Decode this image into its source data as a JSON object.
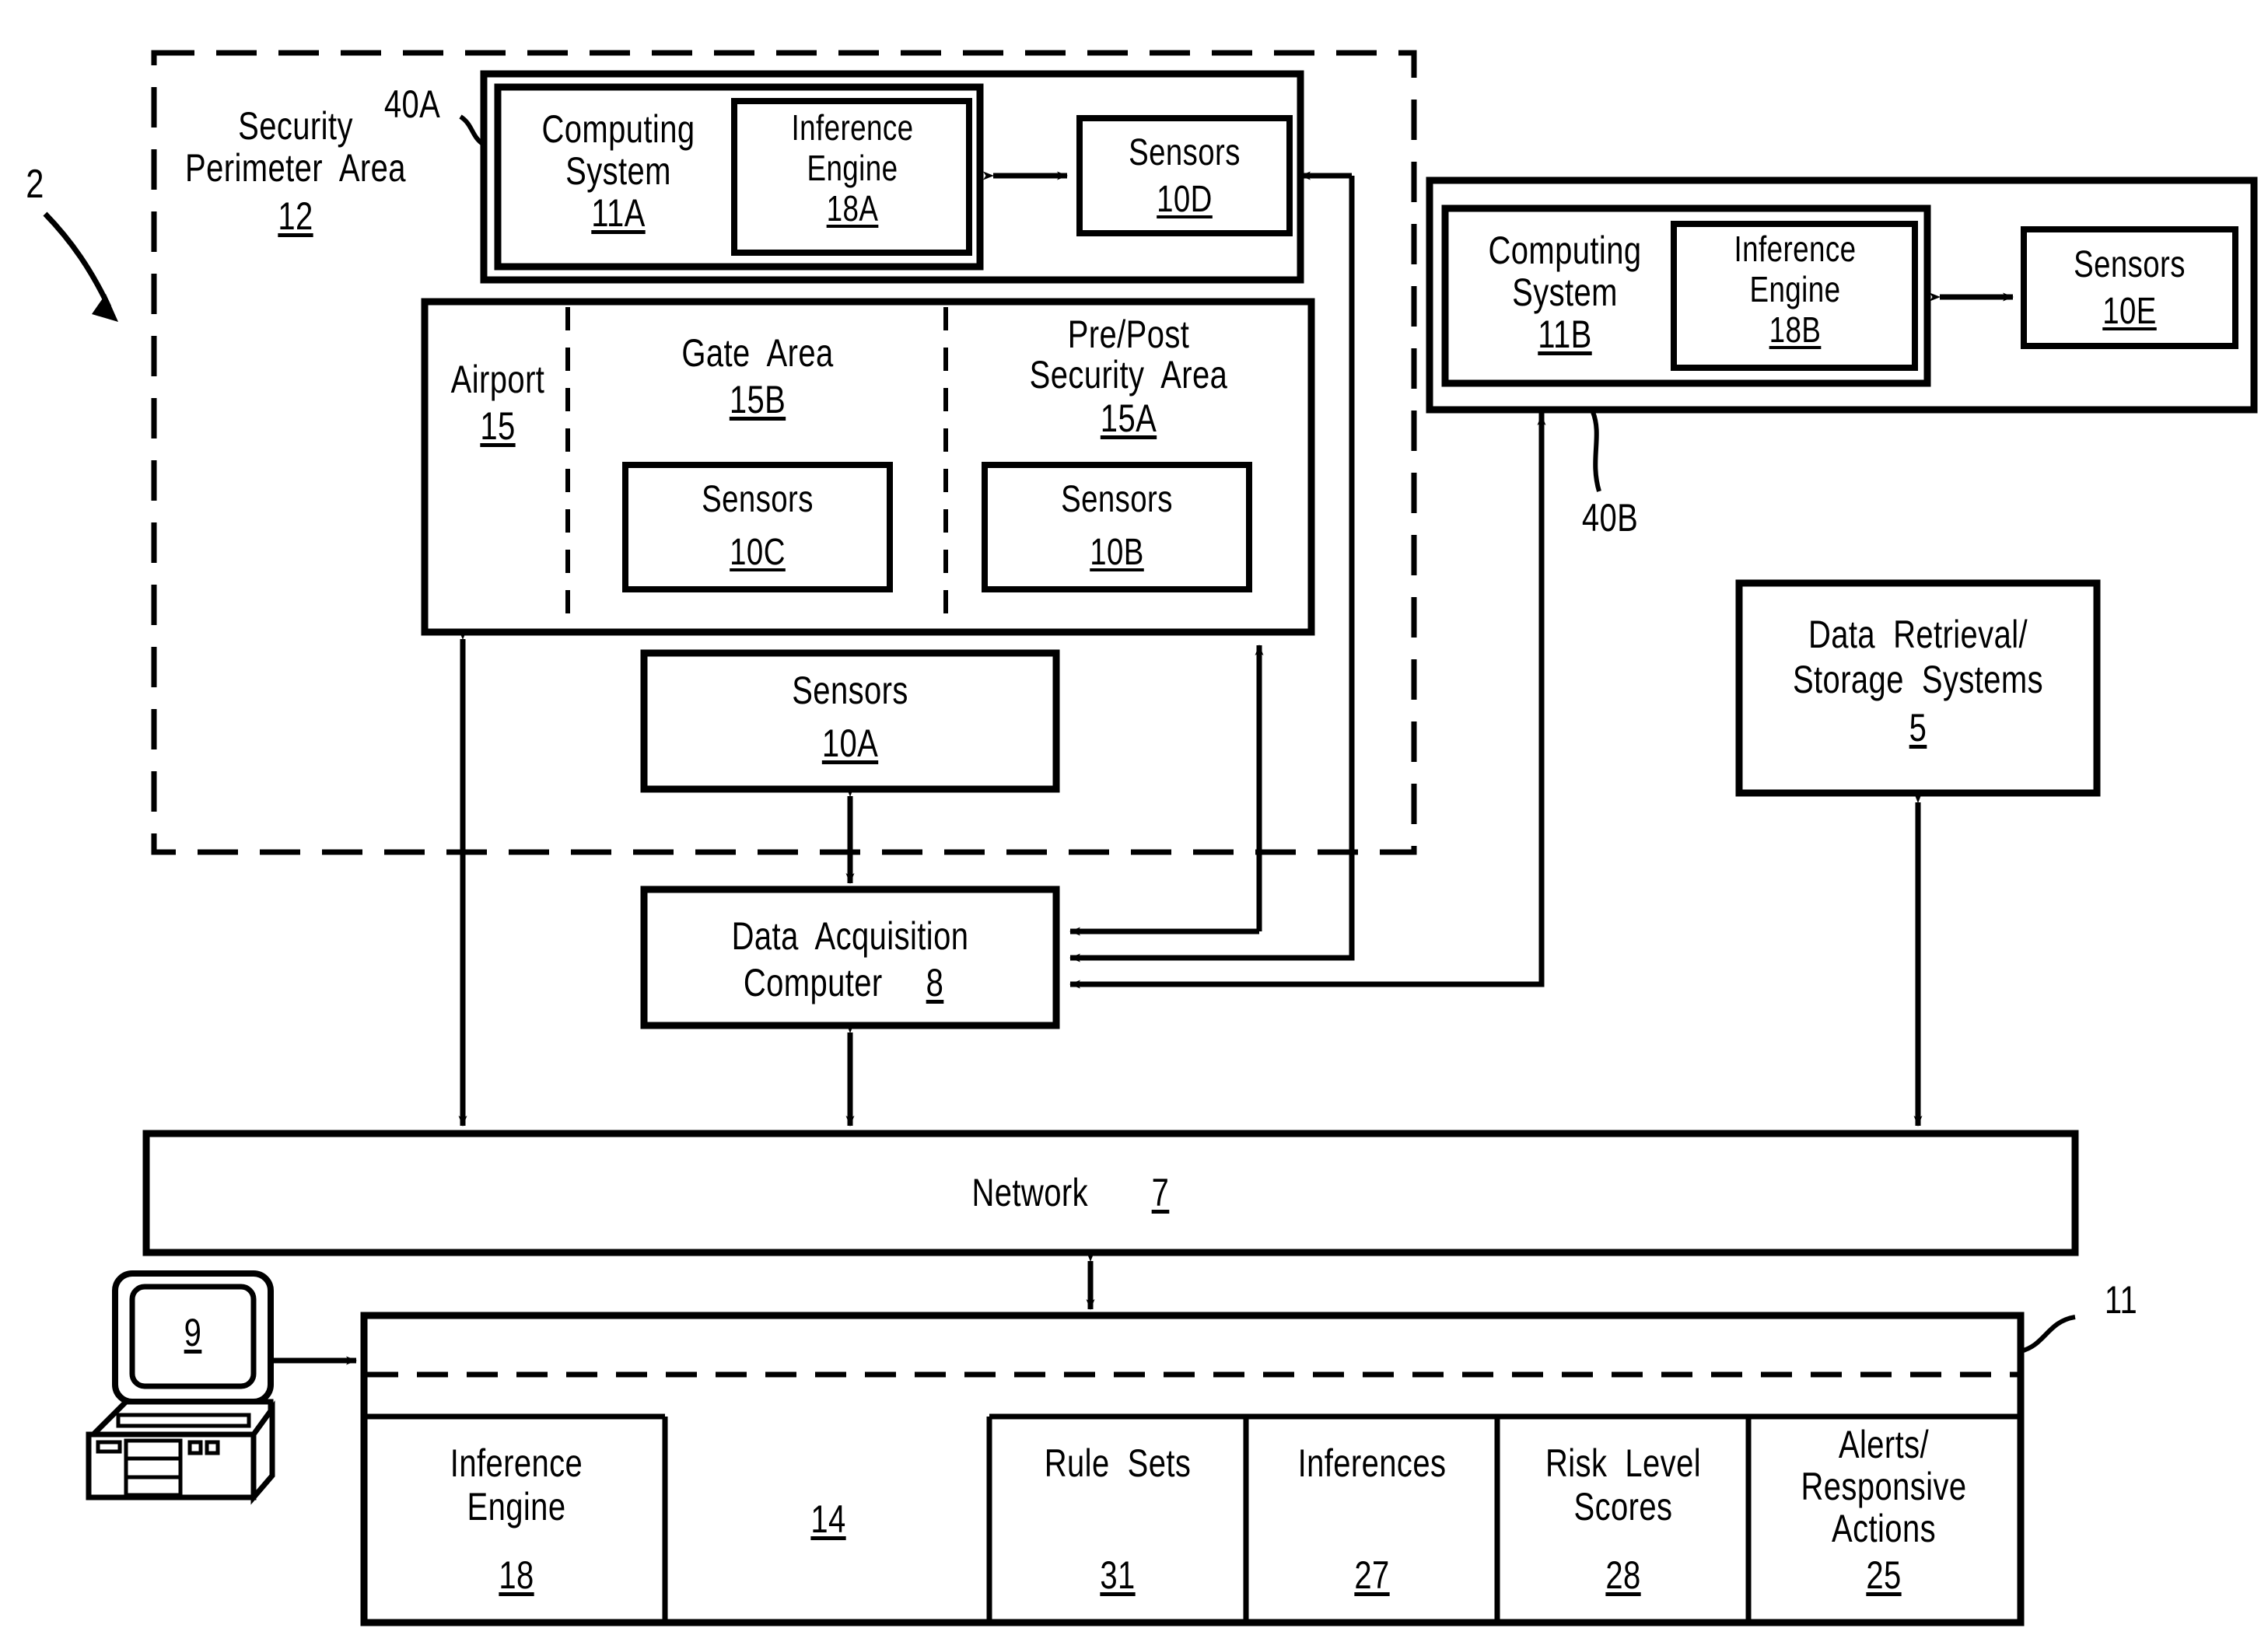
{
  "figure": {
    "root_numeral": "2",
    "type": "patent-block-diagram"
  },
  "security_perimeter": {
    "label_line1": "Security",
    "label_line2": "Perimeter  Area",
    "numeral": "12"
  },
  "node_40A": {
    "leader_label": "40A",
    "computing_system": {
      "line1": "Computing",
      "line2": "System",
      "numeral": "11A"
    },
    "inference_engine": {
      "line1": "Inference",
      "line2": "Engine",
      "numeral": "18A"
    },
    "sensors": {
      "line1": "Sensors",
      "numeral": "10D"
    }
  },
  "node_40B": {
    "leader_label": "40B",
    "computing_system": {
      "line1": "Computing",
      "line2": "System",
      "numeral": "11B"
    },
    "inference_engine": {
      "line1": "Inference",
      "line2": "Engine",
      "numeral": "18B"
    },
    "sensors": {
      "line1": "Sensors",
      "numeral": "10E"
    }
  },
  "airport": {
    "label": "Airport",
    "numeral": "15",
    "gate_area": {
      "line1": "Gate  Area",
      "numeral": "15B",
      "sensors": {
        "line1": "Sensors",
        "numeral": "10C"
      }
    },
    "pre_post_security_area": {
      "line1": "Pre/Post",
      "line2": "Security  Area",
      "numeral": "15A",
      "sensors": {
        "line1": "Sensors",
        "numeral": "10B"
      }
    }
  },
  "sensors_10A": {
    "line1": "Sensors",
    "numeral": "10A"
  },
  "data_acquisition_computer": {
    "line1": "Data  Acquisition",
    "line2": "Computer ",
    "numeral": "8"
  },
  "data_retrieval": {
    "line1": "Data  Retrieval/",
    "line2": "Storage  Systems",
    "numeral": "5"
  },
  "network": {
    "label": "Network ",
    "numeral": "7"
  },
  "workstation": {
    "screen_numeral": "9"
  },
  "analysis_system": {
    "leader_label": "11",
    "center_numeral": "14",
    "cells": [
      {
        "line1": "Inference",
        "line2": "Engine",
        "numeral": "18"
      },
      {
        "line1": "Rule  Sets",
        "line2": "",
        "numeral": "31"
      },
      {
        "line1": "Inferences",
        "line2": "",
        "numeral": "27"
      },
      {
        "line1": "Risk  Level",
        "line2": "Scores",
        "numeral": "28"
      },
      {
        "line1": "Alerts/",
        "line2": "Responsive",
        "line3": "Actions",
        "numeral": "25"
      }
    ]
  },
  "colors": {
    "ink": "#000000",
    "paper": "#ffffff"
  }
}
